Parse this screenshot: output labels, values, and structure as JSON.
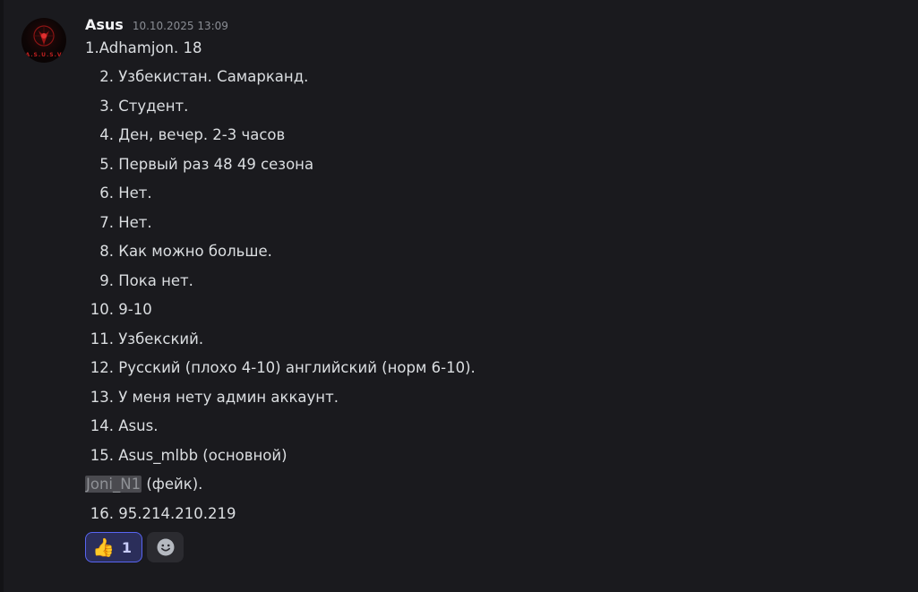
{
  "message": {
    "username": "Asus",
    "timestamp": "10.10.2025 13:09",
    "avatar_text": "A.S.U.S.V",
    "lines": [
      {
        "num": "1.",
        "text": "Adhamjon. 18"
      },
      {
        "num": "2.",
        "text": "Узбекистан. Самарканд."
      },
      {
        "num": "3.",
        "text": "Студент."
      },
      {
        "num": "4.",
        "text": "Ден, вечер. 2-3 часов"
      },
      {
        "num": "5.",
        "text": "Первый раз 48 49 сезона"
      },
      {
        "num": "6.",
        "text": "Нет."
      },
      {
        "num": "7.",
        "text": "Нет."
      },
      {
        "num": "8.",
        "text": "Как можно больше."
      },
      {
        "num": "9.",
        "text": "Пока нет."
      },
      {
        "num": "10.",
        "text": "9-10"
      },
      {
        "num": "11.",
        "text": "Узбекский."
      },
      {
        "num": "12.",
        "text": "Русский (плохо 4-10) английский (норм 6-10)."
      },
      {
        "num": "13.",
        "text": "У меня нету админ аккаунт."
      },
      {
        "num": "14.",
        "text": "Asus."
      },
      {
        "num": "15.",
        "text": "Asus_mlbb (основной)"
      }
    ],
    "mention_line": {
      "mention": "Joni_N1",
      "text": " (фейк)."
    },
    "last_line": {
      "num": "16.",
      "text": "95.214.210.219"
    }
  },
  "reactions": [
    {
      "emoji": "👍",
      "count": "1",
      "icon": "thumbs-up-icon"
    }
  ],
  "add_reaction_icon": "smiley-add-reaction-icon",
  "colors": {
    "background": "#1a1a1e",
    "reaction_active_bg": "#2b2e5a",
    "reaction_border": "#5865f2",
    "mention_bg": "#4a4a4f"
  }
}
